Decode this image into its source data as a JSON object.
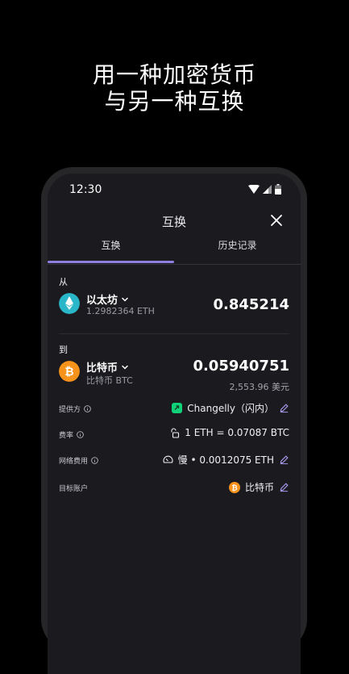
{
  "headline": {
    "line1": "用一种加密货币",
    "line2": "与另一种互换"
  },
  "status": {
    "time": "12:30"
  },
  "header": {
    "title": "互换"
  },
  "tabs": [
    {
      "label": "互换"
    },
    {
      "label": "历史记录"
    }
  ],
  "from": {
    "label": "从",
    "name": "以太坊",
    "balance": "1.2982364 ETH",
    "amount": "0.845214"
  },
  "to": {
    "label": "到",
    "name": "比特币",
    "sub": "比特币 BTC",
    "amount": "0.05940751",
    "fiat": "2,553.96 美元"
  },
  "details": {
    "provider": {
      "label": "提供方",
      "value": "Changelly（闪内）"
    },
    "rate": {
      "label": "费率",
      "value": "1 ETH = 0.07087 BTC"
    },
    "network_fee": {
      "label": "网络费用",
      "value": "慢 • 0.0012075 ETH"
    },
    "target_account": {
      "label": "目标账户",
      "value": "比特币"
    }
  },
  "colors": {
    "accent": "#8c7fe0",
    "eth": "#2ab6c9",
    "btc": "#f7931a",
    "changelly": "#10d078",
    "background": "#1b1b1f"
  }
}
